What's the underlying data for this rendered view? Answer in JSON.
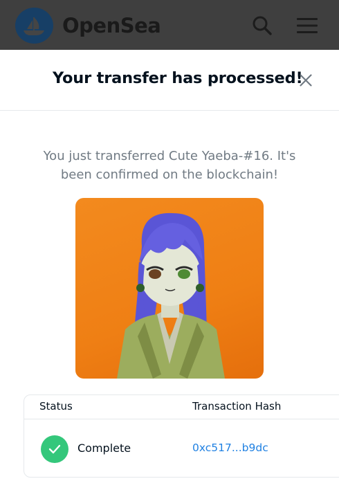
{
  "navbar": {
    "brand": "OpenSea",
    "logo_icon": "opensea-ship-logo",
    "search_icon": "search-icon",
    "menu_icon": "hamburger-menu-icon"
  },
  "modal": {
    "title": "Your transfer has processed!",
    "close_icon": "close-icon",
    "message": "You just transferred Cute Yaeba-#16. It's been confirmed on the blockchain!",
    "nft_image_alt": "Cute Yaeba-#16"
  },
  "table": {
    "headers": {
      "status": "Status",
      "hash": "Transaction Hash"
    },
    "row": {
      "status": "Complete",
      "status_icon": "checkmark-icon",
      "hash": "0xc517...b9dc"
    }
  },
  "colors": {
    "overlay_bar": "#3f3f3f",
    "accent_green": "#34c77b",
    "link_blue": "#2081e2",
    "nft_background": "#f0801a"
  }
}
